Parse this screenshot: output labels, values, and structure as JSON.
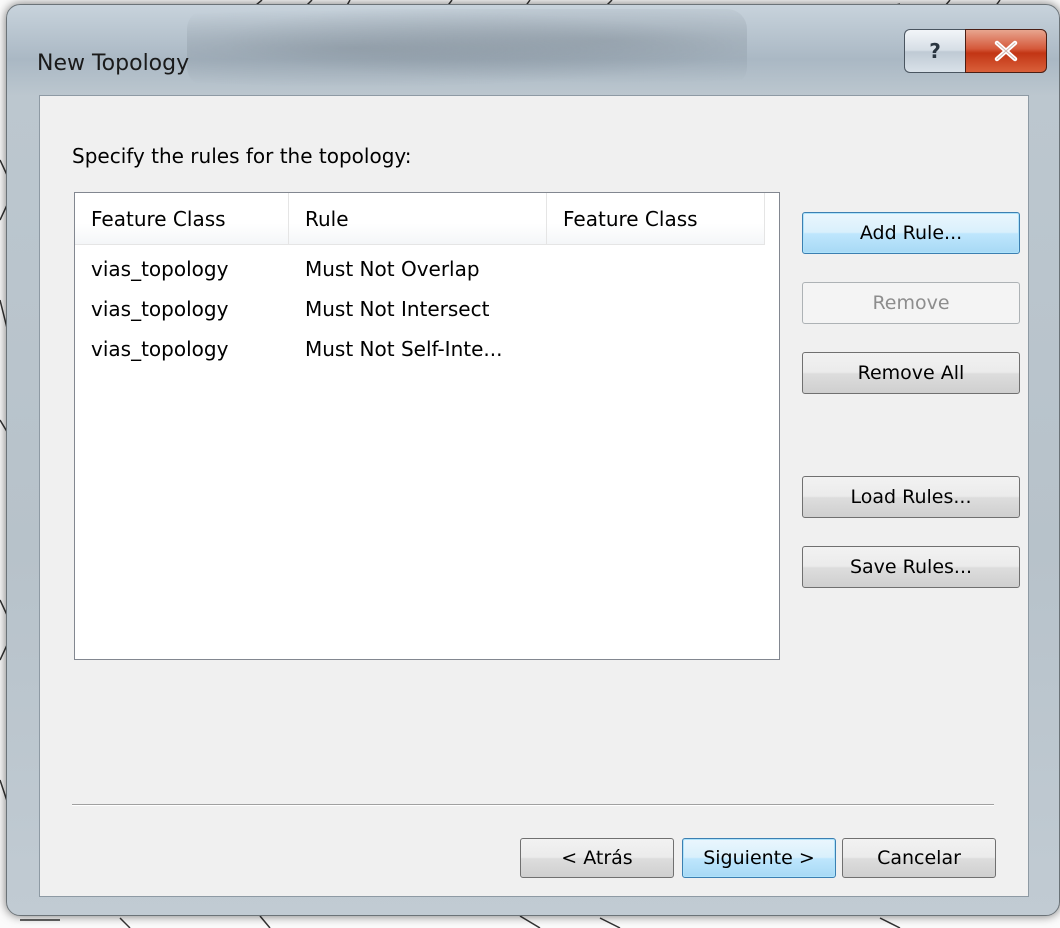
{
  "window": {
    "title": "New Topology",
    "help_glyph": "?",
    "close_icon": "close-icon"
  },
  "prompt": "Specify the rules for the topology:",
  "table": {
    "headers": [
      "Feature Class",
      "Rule",
      "Feature Class"
    ],
    "rows": [
      [
        "vias_topology",
        "Must Not Overlap",
        ""
      ],
      [
        "vias_topology",
        "Must Not Intersect",
        ""
      ],
      [
        "vias_topology",
        "Must Not Self-Inte...",
        ""
      ]
    ]
  },
  "side_buttons": {
    "add_rule": "Add Rule...",
    "remove": "Remove",
    "remove_all": "Remove All",
    "load_rules": "Load Rules...",
    "save_rules": "Save Rules..."
  },
  "footer_buttons": {
    "back": "< Atrás",
    "next": "Siguiente >",
    "cancel": "Cancelar"
  },
  "colors": {
    "default_button_border": "#3c7fb1",
    "close_button": "#c23514"
  }
}
